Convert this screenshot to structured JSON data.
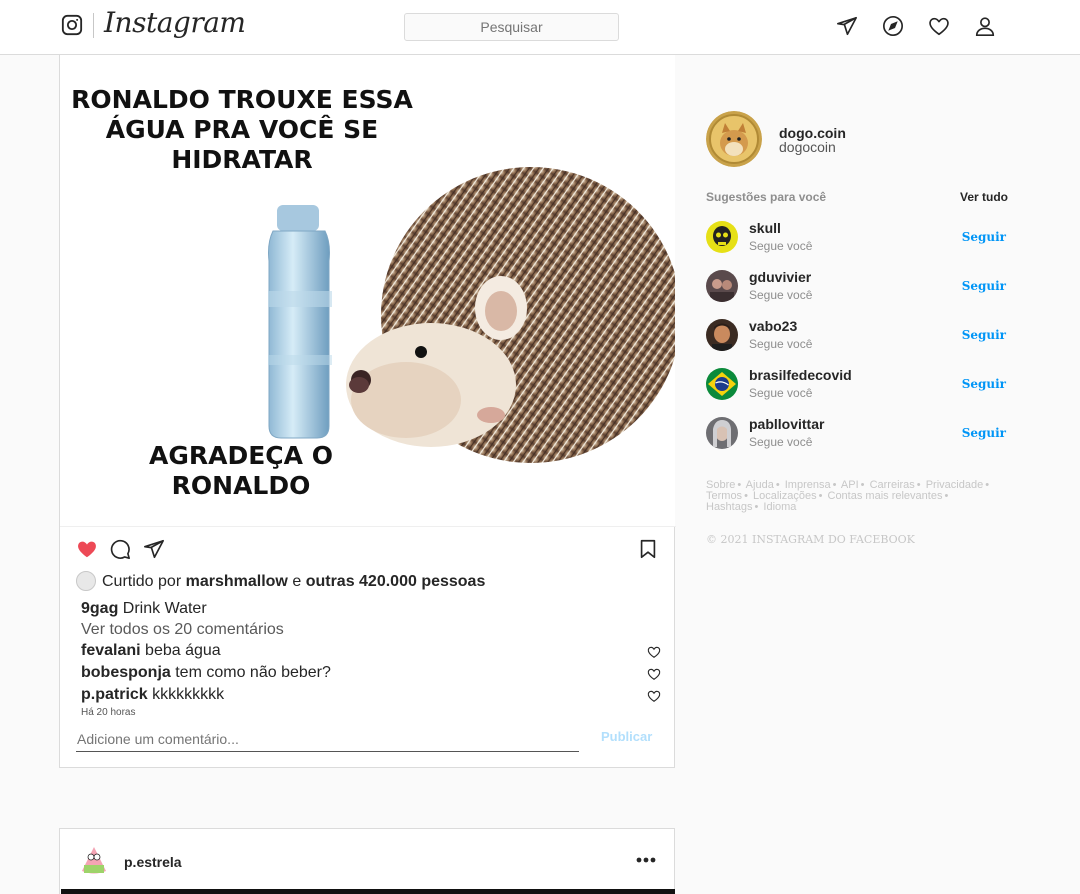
{
  "header": {
    "brand": "Instagram",
    "search_placeholder": "Pesquisar"
  },
  "post": {
    "image_text_top": "RONALDO TROUXE ESSA ÁGUA PRA VOCÊ SE HIDRATAR",
    "image_text_bottom": "AGRADEÇA O RONALDO",
    "liked_prefix": "Curtido por",
    "liked_user": "marshmallow",
    "liked_and": "e",
    "liked_others": "outras 420.000 pessoas",
    "caption_user": "9gag",
    "caption_text": "Drink Water",
    "view_all_comments": "Ver todos os 20 comentários",
    "comments": [
      {
        "user": "fevalani",
        "text": "beba água"
      },
      {
        "user": "bobesponja",
        "text": "tem como não beber?"
      },
      {
        "user": "p.patrick",
        "text": "kkkkkkkkk"
      }
    ],
    "time_ago": "Há 20 horas",
    "comment_placeholder": "Adicione um comentário...",
    "publish_label": "Publicar"
  },
  "post2": {
    "username": "p.estrela"
  },
  "sidebar": {
    "profile_username": "dogo.coin",
    "profile_name": "dogocoin",
    "suggestions_title": "Sugestões para você",
    "see_all": "Ver tudo",
    "suggestions": [
      {
        "user": "skull",
        "sub": "Segue você",
        "action": "Seguir"
      },
      {
        "user": "gduvivier",
        "sub": "Segue você",
        "action": "Seguir"
      },
      {
        "user": "vabo23",
        "sub": "Segue você",
        "action": "Seguir"
      },
      {
        "user": "brasilfedecovid",
        "sub": "Segue você",
        "action": "Seguir"
      },
      {
        "user": "pabllovittar",
        "sub": "Segue você",
        "action": "Seguir"
      }
    ],
    "footer_links": [
      "Sobre",
      "Ajuda",
      "Imprensa",
      "API",
      "Carreiras",
      "Privacidade",
      "Termos",
      "Localizações",
      "Contas mais relevantes",
      "Hashtags",
      "Idioma"
    ],
    "copyright": "© 2021 INSTAGRAM DO FACEBOOK"
  },
  "colors": {
    "like_red": "#ed4956",
    "link_blue": "#0095f6",
    "publish_disabled": "#b2dffc"
  }
}
